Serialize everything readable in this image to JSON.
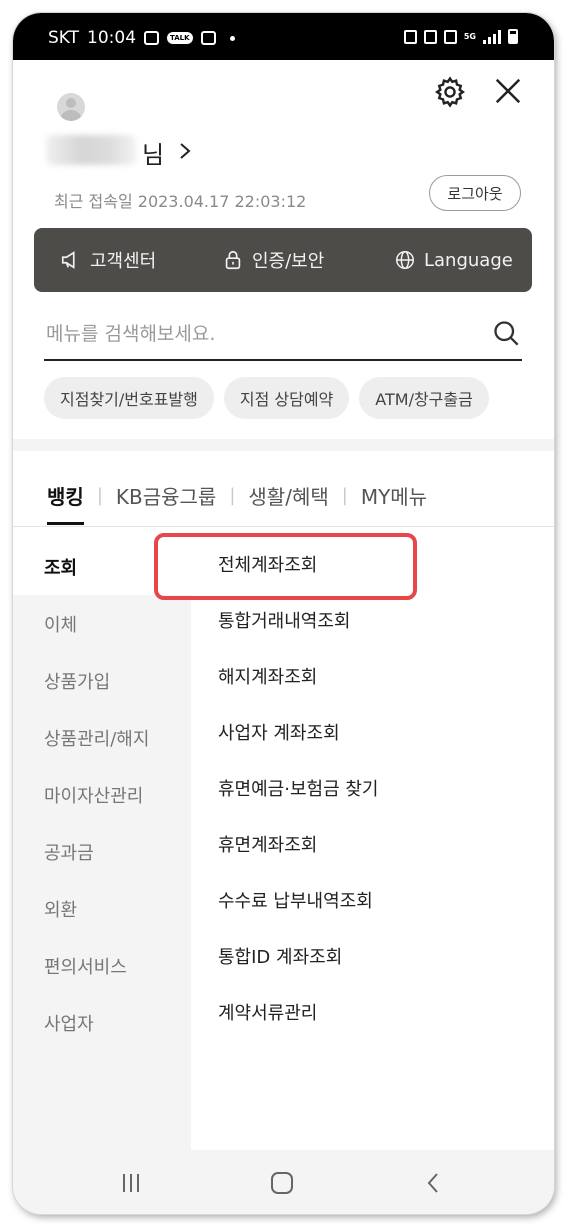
{
  "status_bar": {
    "carrier": "SKT",
    "time": "10:04",
    "talk_badge": "TALK",
    "network": "5G"
  },
  "header": {
    "name_suffix": "님",
    "last_login_label": "최근 접속일 2023.04.17 22:03:12",
    "logout_label": "로그아웃"
  },
  "quick_bar": [
    {
      "label": "고객센터",
      "icon": "speaker-icon"
    },
    {
      "label": "인증/보안",
      "icon": "lock-icon"
    },
    {
      "label": "Language",
      "icon": "globe-icon"
    }
  ],
  "search": {
    "placeholder": "메뉴를 검색해보세요."
  },
  "chips": [
    "지점찾기/번호표발행",
    "지점 상담예약",
    "ATM/창구출금"
  ],
  "tabs": [
    "뱅킹",
    "KB금융그룹",
    "생활/혜택",
    "MY메뉴"
  ],
  "active_tab": "뱅킹",
  "left_menu": [
    "조회",
    "이체",
    "상품가입",
    "상품관리/해지",
    "마이자산관리",
    "공과금",
    "외환",
    "편의서비스",
    "사업자"
  ],
  "active_left_menu": "조회",
  "right_menu": [
    "전체계좌조회",
    "통합거래내역조회",
    "해지계좌조회",
    "사업자 계좌조회",
    "휴면예금·보험금 찾기",
    "휴면계좌조회",
    "수수료 납부내역조회",
    "통합ID 계좌조회",
    "계약서류관리"
  ],
  "highlighted_item": "전체계좌조회",
  "colors": {
    "dark_bar": "#4e4c49",
    "highlight": "#e8474a",
    "side_bg": "#f4f4f4"
  }
}
